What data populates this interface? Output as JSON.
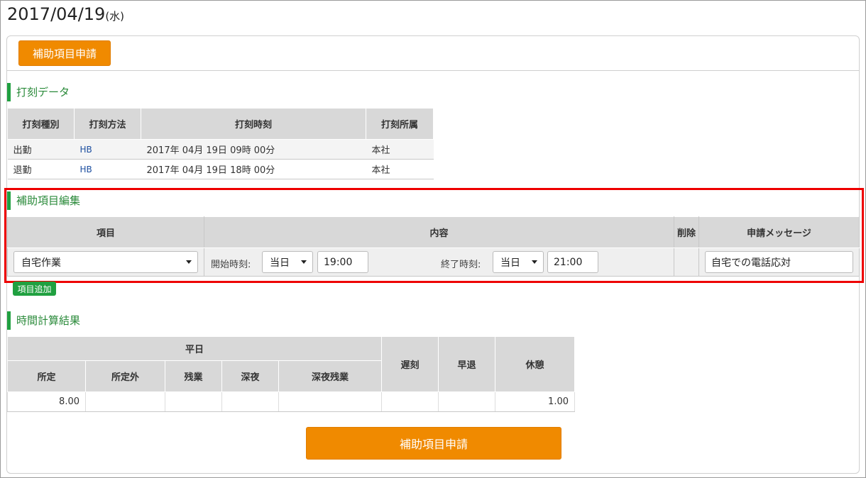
{
  "page": {
    "date": "2017/04/19",
    "weekday": "(水)"
  },
  "buttons": {
    "apply_top": "補助項目申請",
    "apply_bottom": "補助項目申請",
    "add_item": "項目追加"
  },
  "stamp_section": {
    "title": "打刻データ",
    "headers": [
      "打刻種別",
      "打刻方法",
      "打刻時刻",
      "打刻所属"
    ],
    "rows": [
      {
        "type": "出勤",
        "method": "HB",
        "time": "2017年 04月 19日 09時 00分",
        "dept": "本社"
      },
      {
        "type": "退勤",
        "method": "HB",
        "time": "2017年 04月 19日 18時 00分",
        "dept": "本社"
      }
    ]
  },
  "edit_section": {
    "title": "補助項目編集",
    "headers": {
      "item": "項目",
      "content": "内容",
      "delete": "削除",
      "message": "申請メッセージ"
    },
    "row": {
      "item_value": "自宅作業",
      "start_label": "開始時刻:",
      "start_day": "当日",
      "start_time": "19:00",
      "end_label": "終了時刻:",
      "end_day": "当日",
      "end_time": "21:00",
      "message": "自宅での電話応対"
    }
  },
  "calc_section": {
    "title": "時間計算結果",
    "group_header": "平日",
    "headers": {
      "shotei": "所定",
      "shoteigai": "所定外",
      "zangyo": "残業",
      "shinya": "深夜",
      "shinya_zangyo": "深夜残業",
      "chikoku": "遅刻",
      "soutai": "早退",
      "kyukei": "休憩"
    },
    "values": {
      "shotei": "8.00",
      "shoteigai": "",
      "zangyo": "",
      "shinya": "",
      "shinya_zangyo": "",
      "chikoku": "",
      "soutai": "",
      "kyukei": "1.00"
    }
  },
  "colors": {
    "accent_orange": "#f08a00",
    "accent_green": "#20a040",
    "highlight_red": "#e00000"
  }
}
